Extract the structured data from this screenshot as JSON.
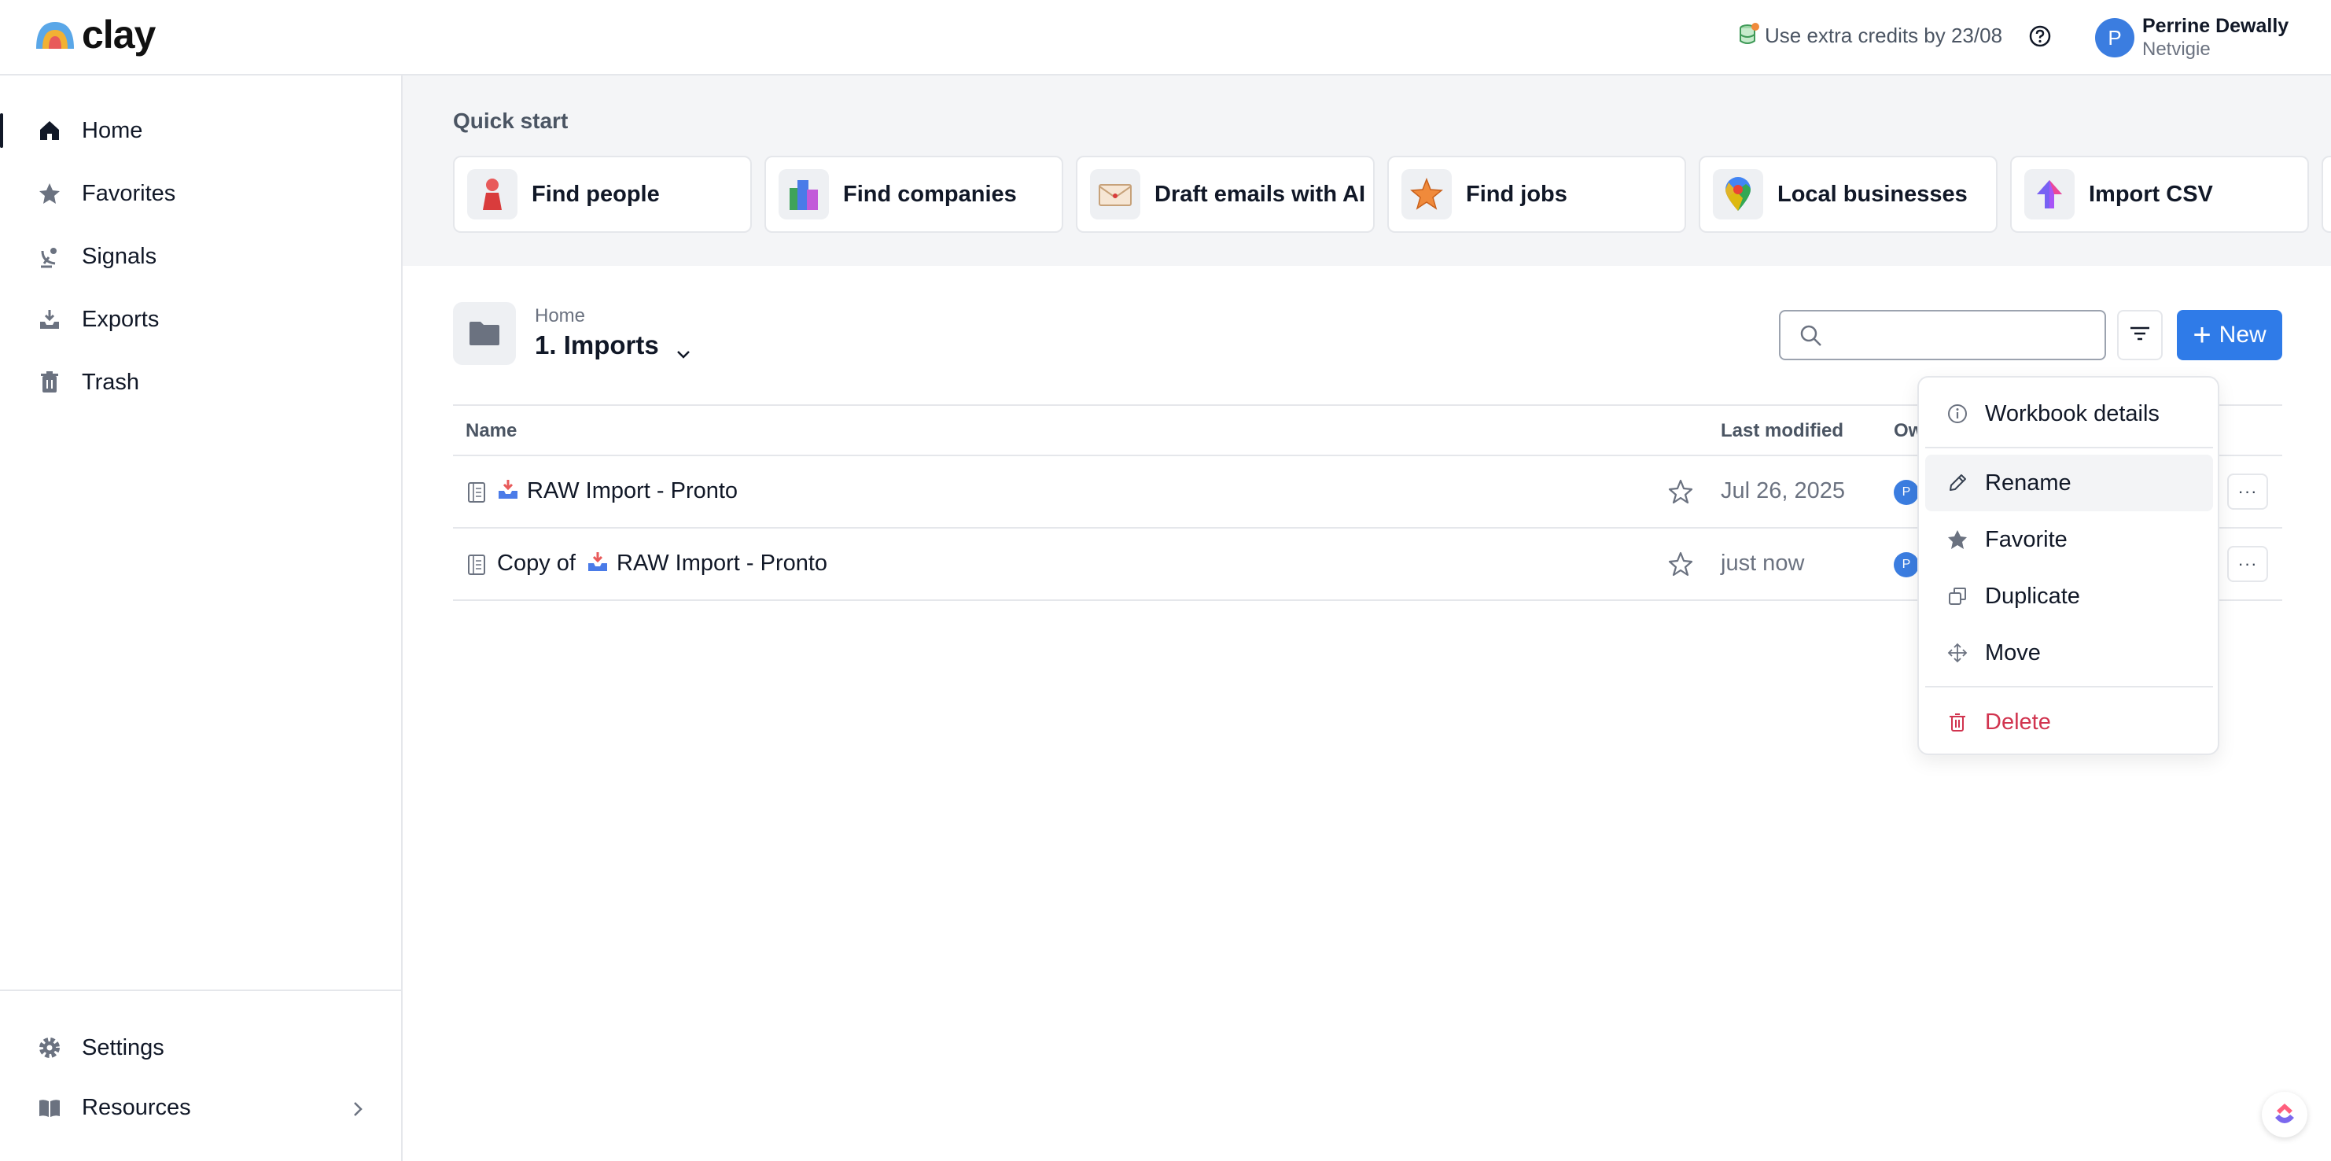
{
  "app": {
    "name": "clay"
  },
  "header": {
    "credits_text": "Use extra credits by 23/08",
    "user": {
      "initial": "P",
      "name": "Perrine Dewally",
      "org": "Netvigie"
    }
  },
  "sidebar": {
    "items": [
      {
        "label": "Home",
        "icon": "home-icon",
        "active": true
      },
      {
        "label": "Favorites",
        "icon": "star-icon"
      },
      {
        "label": "Signals",
        "icon": "signal-icon"
      },
      {
        "label": "Exports",
        "icon": "export-icon"
      },
      {
        "label": "Trash",
        "icon": "trash-icon"
      }
    ],
    "bottom": [
      {
        "label": "Settings",
        "icon": "gear-icon"
      },
      {
        "label": "Resources",
        "icon": "book-icon"
      }
    ]
  },
  "quick_start": {
    "title": "Quick start",
    "cards": [
      {
        "label": "Find people",
        "icon": "person-icon"
      },
      {
        "label": "Find companies",
        "icon": "buildings-icon"
      },
      {
        "label": "Draft emails with AI",
        "icon": "envelope-icon"
      },
      {
        "label": "Find jobs",
        "icon": "star-badge-icon"
      },
      {
        "label": "Local businesses",
        "icon": "map-pin-icon"
      },
      {
        "label": "Import CSV",
        "icon": "upload-arrow-icon"
      }
    ]
  },
  "folder": {
    "breadcrumb": "Home",
    "title": "1. Imports"
  },
  "toolbar": {
    "search_placeholder": "",
    "new_label": "New"
  },
  "table": {
    "headers": {
      "name": "Name",
      "modified": "Last modified",
      "owner": "Ow"
    },
    "rows": [
      {
        "prefix": "",
        "name": "RAW Import - Pronto",
        "modified": "Jul 26, 2025",
        "owner": "P"
      },
      {
        "prefix": "Copy of",
        "name": "RAW Import - Pronto",
        "modified": "just now",
        "owner": "P"
      }
    ]
  },
  "context_menu": {
    "items": [
      {
        "label": "Workbook details",
        "icon": "info-icon"
      },
      {
        "label": "Rename",
        "icon": "pencil-icon"
      },
      {
        "label": "Favorite",
        "icon": "star-icon"
      },
      {
        "label": "Duplicate",
        "icon": "duplicate-icon"
      },
      {
        "label": "Move",
        "icon": "move-icon"
      },
      {
        "label": "Delete",
        "icon": "trash-icon"
      }
    ]
  },
  "colors": {
    "primary": "#2f7be8",
    "danger": "#d1344f",
    "text": "#111827",
    "muted": "#6b7280"
  }
}
